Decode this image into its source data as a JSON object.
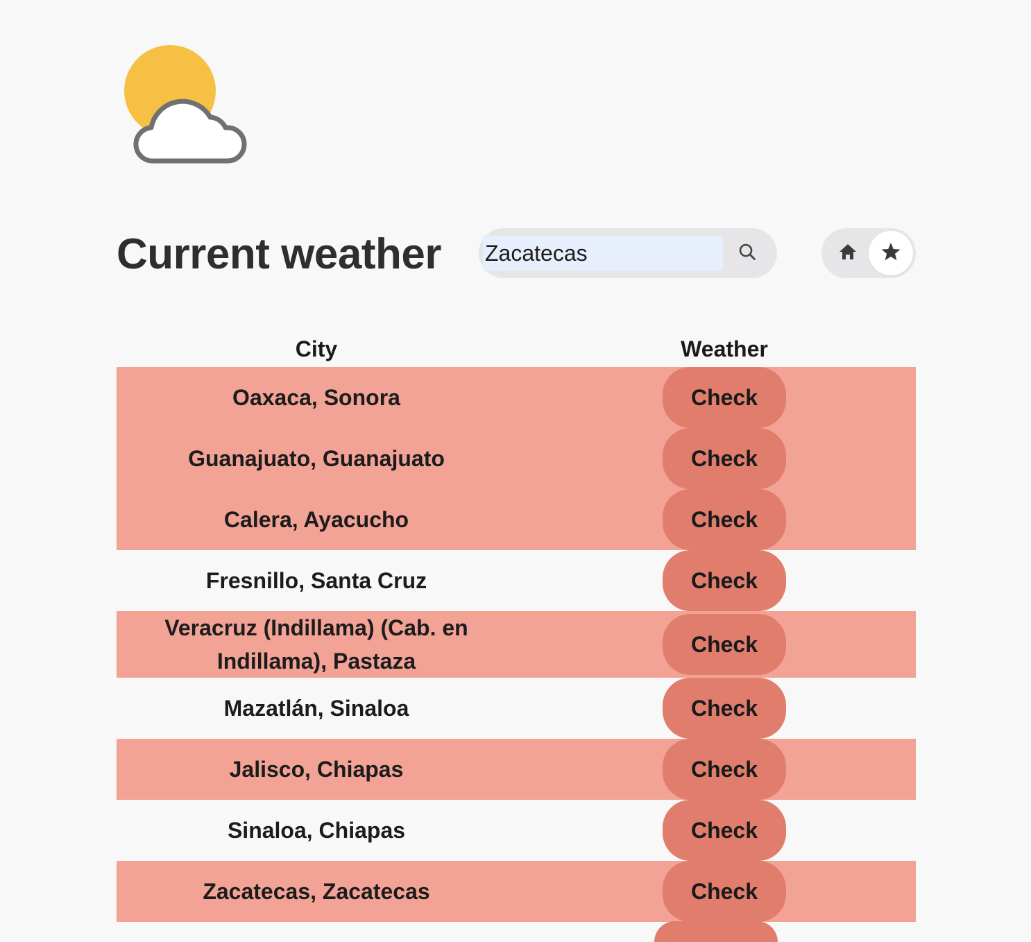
{
  "header": {
    "title": "Current weather",
    "logo_icon": "sun-cloud-icon"
  },
  "search": {
    "value": "Zacatecas",
    "placeholder": "",
    "button_icon": "search-icon"
  },
  "view_toggle": {
    "home_icon": "home-icon",
    "favorites_icon": "star-icon",
    "active": "favorites"
  },
  "table": {
    "columns": [
      "City",
      "Weather"
    ],
    "rows": [
      {
        "city": "Oaxaca, Sonora",
        "action": "Check",
        "highlight": true
      },
      {
        "city": "Guanajuato, Guanajuato",
        "action": "Check",
        "highlight": true
      },
      {
        "city": "Calera, Ayacucho",
        "action": "Check",
        "highlight": true
      },
      {
        "city": "Fresnillo, Santa Cruz",
        "action": "Check",
        "highlight": false
      },
      {
        "city": "Veracruz (Indillama) (Cab. en Indillama), Pastaza",
        "action": "Check",
        "highlight": true
      },
      {
        "city": "Mazatlán, Sinaloa",
        "action": "Check",
        "highlight": false
      },
      {
        "city": "Jalisco, Chiapas",
        "action": "Check",
        "highlight": true
      },
      {
        "city": "Sinaloa, Chiapas",
        "action": "Check",
        "highlight": false
      },
      {
        "city": "Zacatecas, Zacatecas",
        "action": "Check",
        "highlight": true
      }
    ]
  },
  "colors": {
    "background": "#f8f8f8",
    "row_highlight": "#f2a396",
    "button": "#e07d6d",
    "sun": "#f5c044",
    "cloud_stroke": "#707070"
  }
}
